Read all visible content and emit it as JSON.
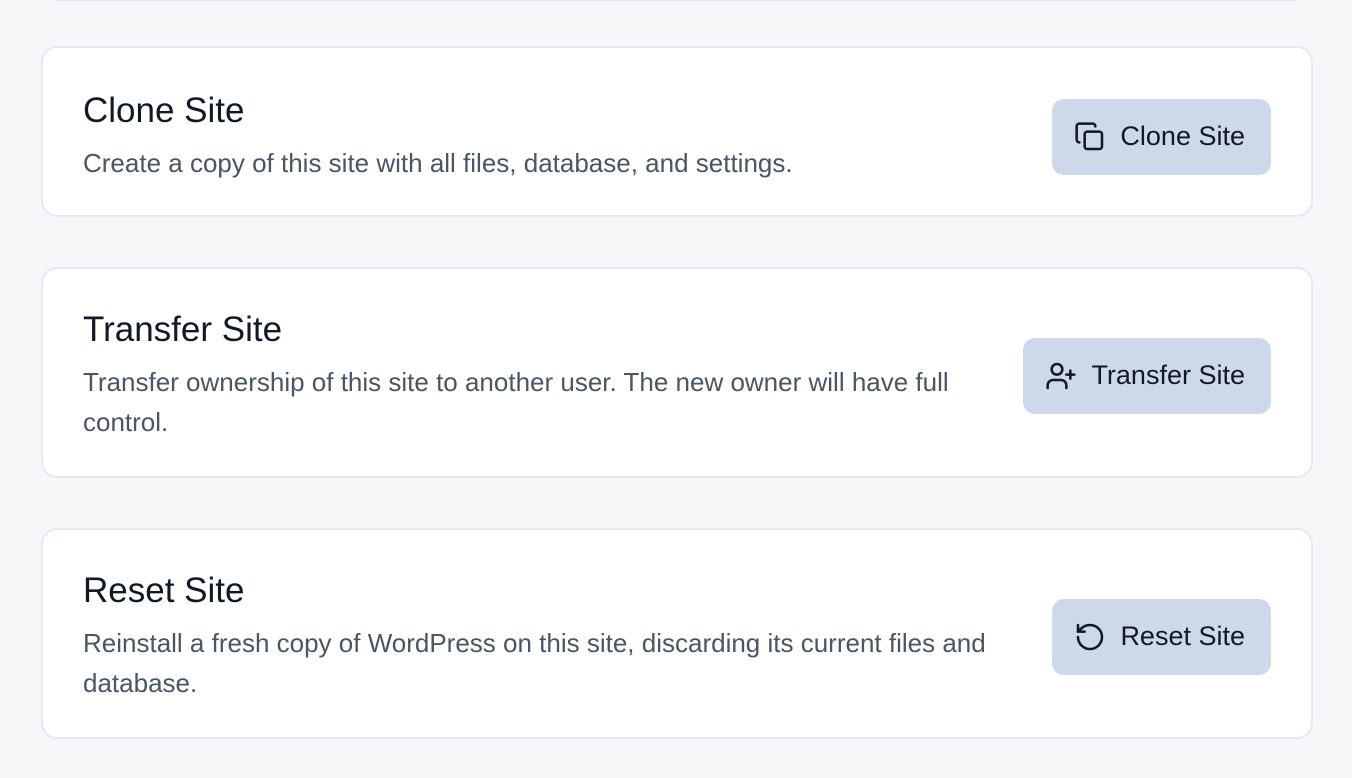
{
  "cards": [
    {
      "title": "Clone Site",
      "description": "Create a copy of this site with all files, database, and settings.",
      "button_label": "Clone Site",
      "icon": "copy-icon"
    },
    {
      "title": "Transfer Site",
      "description": "Transfer ownership of this site to another user. The new owner will have full control.",
      "button_label": "Transfer Site",
      "icon": "user-plus-icon"
    },
    {
      "title": "Reset Site",
      "description": "Reinstall a fresh copy of WordPress on this site, discarding its current files and database.",
      "button_label": "Reset Site",
      "icon": "reset-icon"
    }
  ],
  "colors": {
    "page_background": "#f6f7f9",
    "card_background": "#ffffff",
    "card_border": "#e6e8f2",
    "button_background": "#cdd9ea",
    "title_text": "#111827",
    "description_text": "#4b5563"
  }
}
